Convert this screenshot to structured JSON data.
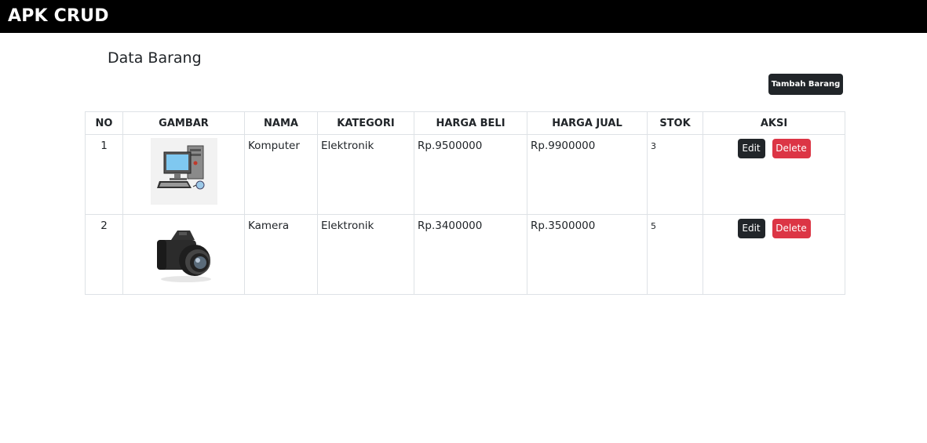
{
  "navbar": {
    "brand": "APK CRUD"
  },
  "main": {
    "title": "Data Barang",
    "add_button_label": "Tambah Barang"
  },
  "table": {
    "headers": [
      "NO",
      "GAMBAR",
      "NAMA",
      "KATEGORI",
      "HARGA BELI",
      "HARGA JUAL",
      "STOK",
      "AKSI"
    ],
    "rows": [
      {
        "no": "1",
        "image_icon": "computer-image",
        "nama": "Komputer",
        "kategori": "Elektronik",
        "harga_beli": "Rp.9500000",
        "harga_jual": "Rp.9900000",
        "stok": "3"
      },
      {
        "no": "2",
        "image_icon": "camera-image",
        "nama": "Kamera",
        "kategori": "Elektronik",
        "harga_beli": "Rp.3400000",
        "harga_jual": "Rp.3500000",
        "stok": "5"
      }
    ],
    "edit_label": "Edit",
    "delete_label": "Delete"
  },
  "colors": {
    "navbar_bg": "#000000",
    "dark_button": "#212529",
    "danger_button": "#dc3545",
    "border": "#dee2e6"
  }
}
